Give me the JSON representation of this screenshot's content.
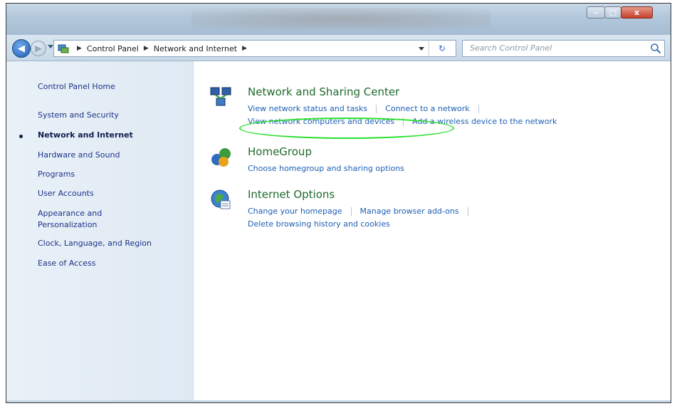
{
  "window": {
    "title_buttons": {
      "minimize": "-",
      "maximize": "▢",
      "close": "x"
    }
  },
  "address": {
    "crumbs": [
      "Control Panel",
      "Network and Internet"
    ],
    "search_placeholder": "Search Control Panel",
    "icon": "control-panel-icon"
  },
  "sidebar": {
    "items": [
      {
        "label": "Control Panel Home"
      },
      {
        "label": "System and Security"
      },
      {
        "label": "Network and Internet",
        "active": true
      },
      {
        "label": "Hardware and Sound"
      },
      {
        "label": "Programs"
      },
      {
        "label": "User Accounts"
      },
      {
        "label": "Appearance and Personalization"
      },
      {
        "label": "Clock, Language, and Region"
      },
      {
        "label": "Ease of Access"
      }
    ]
  },
  "categories": [
    {
      "title": "Network and Sharing Center",
      "icon": "network-sharing-icon",
      "links_row1": [
        "View network status and tasks",
        "Connect to a network"
      ],
      "links_row2": [
        "View network computers and devices",
        "Add a wireless device to the network"
      ]
    },
    {
      "title": "HomeGroup",
      "icon": "homegroup-icon",
      "links_row1": [
        "Choose homegroup and sharing options"
      ]
    },
    {
      "title": "Internet Options",
      "icon": "internet-options-icon",
      "links_row1": [
        "Change your homepage",
        "Manage browser add-ons"
      ],
      "links_row2": [
        "Delete browsing history and cookies"
      ]
    }
  ],
  "colors": {
    "category_title": "#1f6a2b",
    "link": "#1d5fb3",
    "highlight": "#27e02a"
  }
}
